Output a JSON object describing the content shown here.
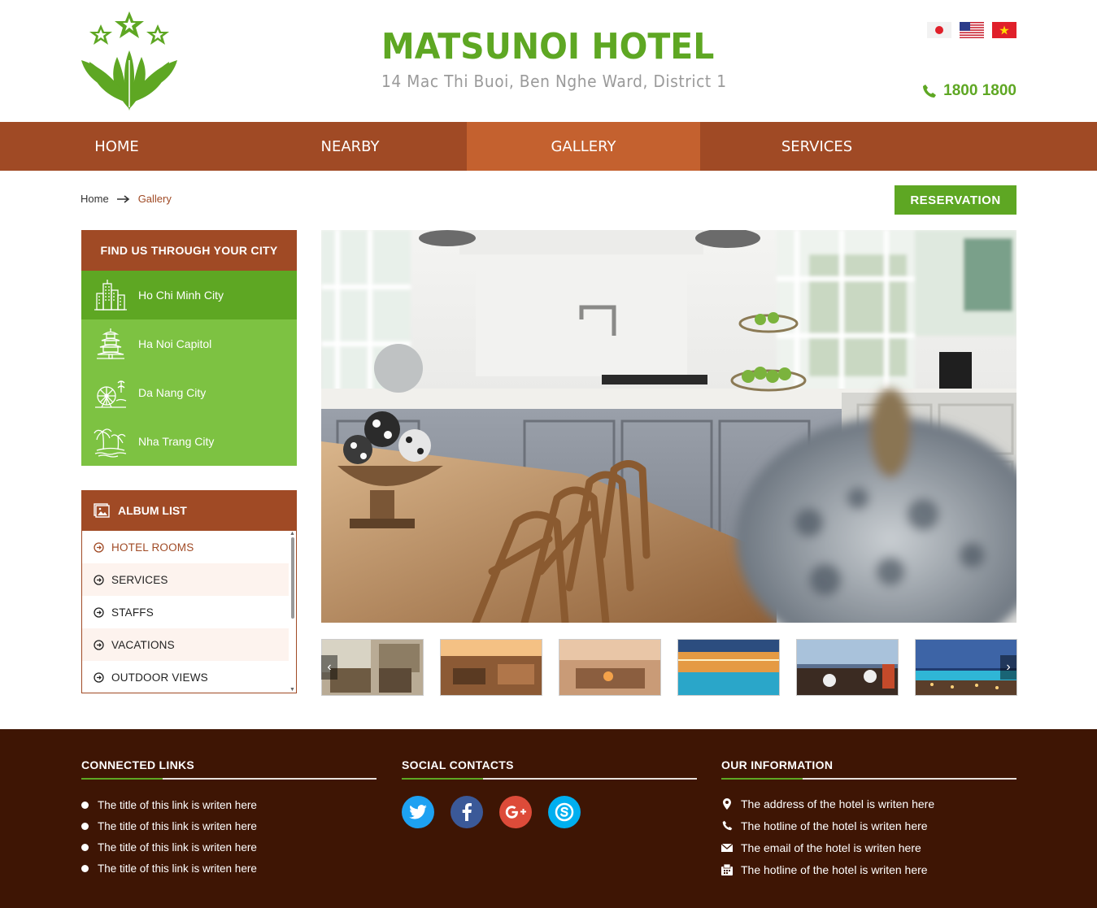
{
  "header": {
    "title": "MATSUNOI HOTEL",
    "address": "14 Mac Thi Buoi, Ben Nghe Ward, District 1",
    "phone": "1800 1800",
    "languages": [
      "japan-flag-icon",
      "usa-flag-icon",
      "vietnam-flag-icon"
    ]
  },
  "nav": {
    "items": [
      {
        "label": "HOME"
      },
      {
        "label": "NEARBY"
      },
      {
        "label": "GALLERY"
      },
      {
        "label": "SERVICES"
      }
    ],
    "active": "GALLERY"
  },
  "breadcrumb": {
    "home": "Home",
    "current": "Gallery"
  },
  "reservation_label": "RESERVATION",
  "city_panel": {
    "title": "FIND US THROUGH YOUR CITY",
    "items": [
      {
        "label": "Ho Chi Minh City",
        "icon": "city-buildings-icon"
      },
      {
        "label": "Ha Noi Capitol",
        "icon": "pagoda-icon"
      },
      {
        "label": "Da Nang City",
        "icon": "ferris-wheel-icon"
      },
      {
        "label": "Nha Trang City",
        "icon": "palm-island-icon"
      }
    ]
  },
  "album_panel": {
    "title": "ALBUM LIST",
    "items": [
      {
        "label": "HOTEL ROOMS"
      },
      {
        "label": "SERVICES"
      },
      {
        "label": "STAFFS"
      },
      {
        "label": "VACATIONS"
      },
      {
        "label": "OUTDOOR VIEWS"
      }
    ]
  },
  "footer": {
    "connected_links": {
      "title": "CONNECTED LINKS",
      "items": [
        "The title of this link is writen here",
        "The title of this link is writen here",
        "The title of this link is writen here",
        "The title of this link is writen here"
      ]
    },
    "social": {
      "title": "SOCIAL CONTACTS",
      "items": [
        "twitter-icon",
        "facebook-icon",
        "google-plus-icon",
        "skype-icon"
      ]
    },
    "info": {
      "title": "OUR INFORMATION",
      "items": [
        {
          "icon": "map-pin-icon",
          "text": "The address of the hotel is writen here"
        },
        {
          "icon": "phone-icon",
          "text": "The hotline of the hotel is writen here"
        },
        {
          "icon": "envelope-icon",
          "text": "The email of the hotel is writen here"
        },
        {
          "icon": "fax-icon",
          "text": "The hotline of the hotel is writen here"
        }
      ]
    }
  },
  "colors": {
    "brand_green": "#5ea723",
    "brand_brown": "#a04a25",
    "nav_active": "#c4612f",
    "footer_bg": "#3e1504"
  }
}
